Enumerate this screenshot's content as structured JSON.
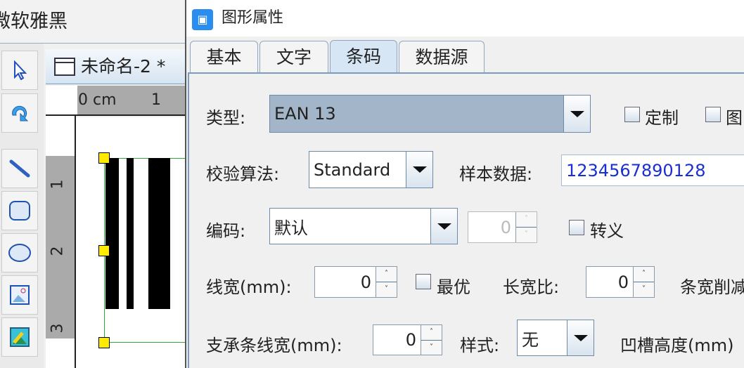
{
  "app": {
    "font_name": "微软雅黑",
    "doc_tab": "未命名-2 *",
    "ruler_top": [
      "0 cm",
      "1"
    ],
    "ruler_left": [
      "1",
      "2",
      "3"
    ],
    "tools": [
      "select-tool",
      "rotate-tool",
      "line-tool",
      "rounded-rect-tool",
      "ellipse-tool",
      "image-tool",
      "picture-tool"
    ]
  },
  "dialog": {
    "title": "图形属性",
    "tabs": [
      "基本",
      "文字",
      "条码",
      "数据源"
    ],
    "active_tab": "条码",
    "type_label": "类型:",
    "type_value": "EAN 13",
    "custom_label": "定制",
    "graphic_label": "图",
    "check_label": "校验算法:",
    "check_value": "Standard",
    "sample_label": "样本数据:",
    "sample_value": "1234567890128",
    "encoding_label": "编码:",
    "encoding_value": "默认",
    "encoding_spin": "0",
    "escape_label": "转义",
    "linewidth_label": "线宽(mm):",
    "linewidth_value": "0",
    "optimal_label": "最优",
    "ratio_label": "长宽比:",
    "ratio_value": "0",
    "reduce_label": "条宽削减",
    "bearer_label": "支承条线宽(mm):",
    "bearer_value": "0",
    "style_label": "样式:",
    "style_value": "无",
    "notch_label": "凹槽高度(mm)"
  },
  "colors": {
    "accent": "#2a8df0",
    "selected_combo": "#a3b5c8",
    "sample_text": "#1a2fd0",
    "handle": "#ffea00"
  }
}
